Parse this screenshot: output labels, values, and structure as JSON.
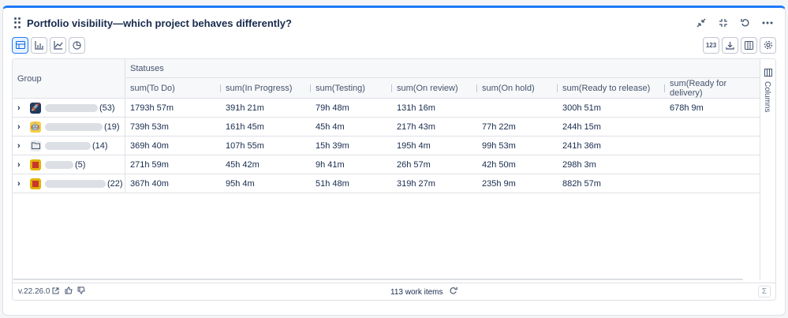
{
  "header": {
    "title": "Portfolio visibility—which project behaves differently?",
    "icons": [
      "collapse-icon",
      "minimize-icon",
      "refresh-icon",
      "more-icon"
    ]
  },
  "toolbar": {
    "views": [
      "table-view",
      "bar-chart-view",
      "line-chart-view",
      "pie-chart-view"
    ],
    "active_view": "table-view",
    "format_label": "123",
    "right_icons": [
      "download-icon",
      "columns-icon",
      "settings-icon"
    ]
  },
  "table": {
    "group_header": "Group",
    "statuses_header": "Statuses",
    "columns": [
      "sum(To Do)",
      "sum(In Progress)",
      "sum(Testing)",
      "sum(On review)",
      "sum(On hold)",
      "sum(Ready to release)",
      "sum(Ready for delivery)"
    ],
    "rows": [
      {
        "count": "(53)",
        "icon": "rocket-icon",
        "icon_color": "#1c3a5e",
        "values": [
          "1793h 57m",
          "391h 21m",
          "79h 48m",
          "131h 16m",
          "",
          "300h 51m",
          "678h 9m"
        ]
      },
      {
        "count": "(19)",
        "icon": "robot-icon",
        "icon_color": "#f5cd47",
        "values": [
          "739h 53m",
          "161h 45m",
          "45h 4m",
          "217h 43m",
          "77h 22m",
          "244h 15m",
          ""
        ]
      },
      {
        "count": "(14)",
        "icon": "folder-icon",
        "icon_color": "#e9ebee",
        "values": [
          "369h 40m",
          "107h 55m",
          "15h 39m",
          "195h 4m",
          "99h 53m",
          "241h 36m",
          ""
        ]
      },
      {
        "count": "(5)",
        "icon": "flag-icon",
        "icon_color": "#e2b203",
        "values": [
          "271h 59m",
          "45h 42m",
          "9h 41m",
          "26h 57m",
          "42h 50m",
          "298h 3m",
          ""
        ]
      },
      {
        "count": "(22)",
        "icon": "flag-icon",
        "icon_color": "#e2b203",
        "values": [
          "367h 40m",
          "95h 4m",
          "51h 48m",
          "319h 27m",
          "235h 9m",
          "882h 57m",
          ""
        ]
      }
    ]
  },
  "side_panel": {
    "label": "Columns"
  },
  "footer": {
    "version": "v.22.26.0",
    "work_items": "113 work items",
    "sigma": "Σ"
  },
  "colors": {
    "accent": "#1d7afc",
    "border": "#dfe1e6",
    "text": "#172b4d"
  }
}
